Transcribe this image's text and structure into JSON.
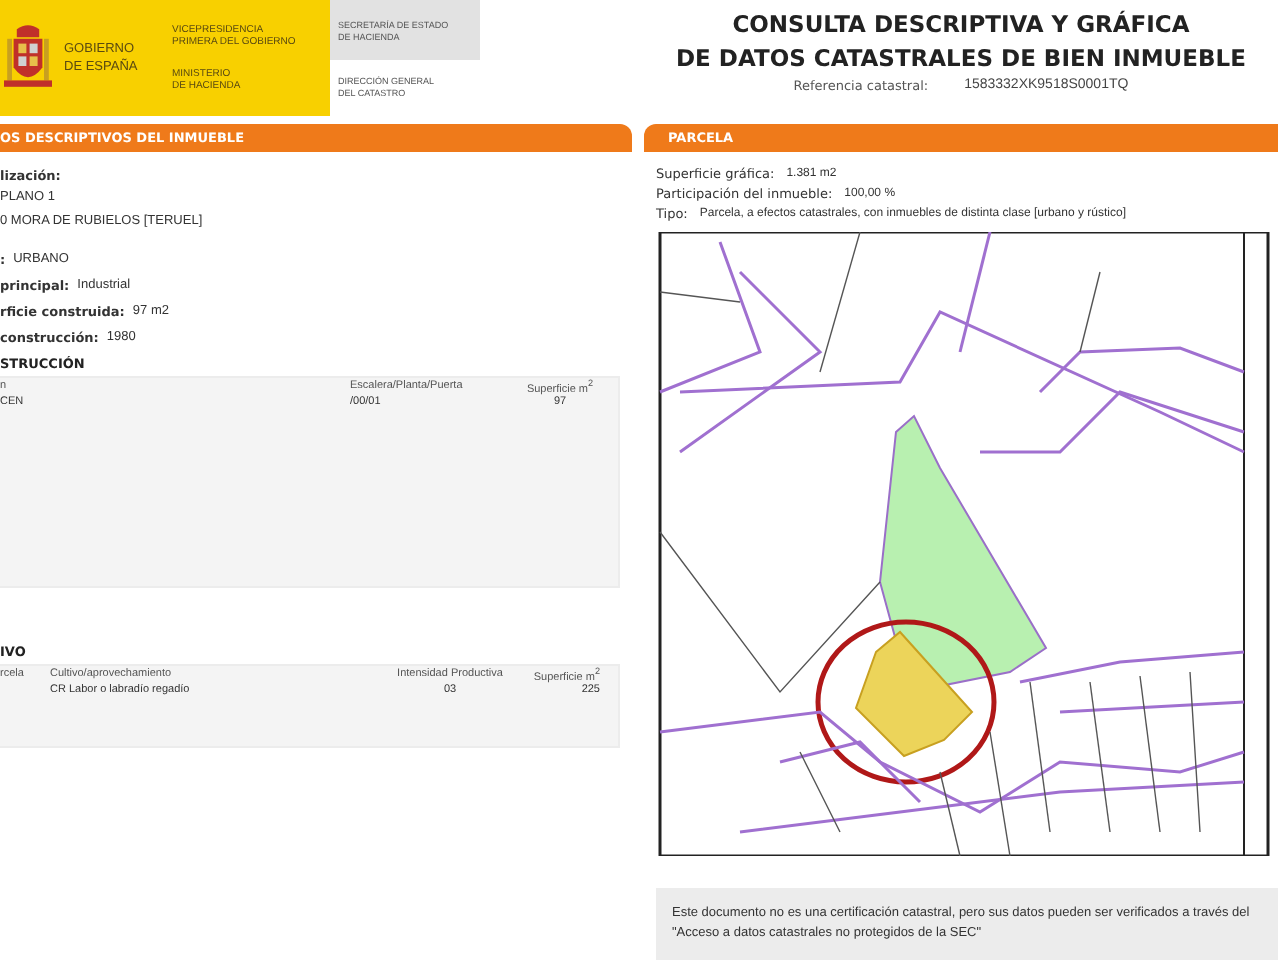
{
  "header": {
    "government": [
      "GOBIERNO",
      "DE ESPAÑA"
    ],
    "vicepresidency": [
      "VICEPRESIDENCIA",
      "PRIMERA DEL GOBIERNO"
    ],
    "ministry": [
      "MINISTERIO",
      "DE HACIENDA"
    ],
    "secretariat": [
      "SECRETARÍA DE ESTADO",
      "DE HACIENDA"
    ],
    "directorate": [
      "DIRECCIÓN GENERAL",
      "DEL CATASTRO"
    ],
    "title": [
      "CONSULTA DESCRIPTIVA Y GRÁFICA",
      "DE DATOS CATASTRALES DE BIEN INMUEBLE"
    ],
    "reference_label": "Referencia catastral:",
    "reference_value": "1583332XK9518S0001TQ"
  },
  "descriptive": {
    "heading": "OS DESCRIPTIVOS DEL INMUEBLE",
    "location_label": "lización:",
    "location_lines": [
      "PLANO 1",
      "0 MORA DE RUBIELOS [TERUEL]"
    ],
    "fields": [
      {
        "label": ": ",
        "value": "URBANO"
      },
      {
        "label": "principal:",
        "value": "Industrial"
      },
      {
        "label": "rficie construida:",
        "value": "97 m2"
      },
      {
        "label": "construcción:",
        "value": "1980"
      }
    ],
    "construction": {
      "heading": "STRUCCIÓN",
      "columns": [
        "n",
        "Escalera/Planta/Puerta",
        "Superficie m$^{2}$"
      ],
      "rows": [
        [
          "CEN",
          "/00/01",
          "97"
        ]
      ]
    },
    "crop": {
      "heading": "IVO",
      "columns": [
        "rcela",
        "Cultivo/aprovechamiento",
        "Intensidad Productiva",
        "Superficie m$^{2}$"
      ],
      "rows": [
        [
          "",
          "CR Labor o labradío regadío",
          "03",
          "225"
        ]
      ]
    }
  },
  "parcel": {
    "heading": "PARCELA",
    "fields": [
      {
        "label": "Superficie gráfica:",
        "value": "1.381 m2"
      },
      {
        "label": "Participación del inmueble:",
        "value": "100,00 %"
      },
      {
        "label": "Tipo:",
        "value": "Parcela, a efectos catastrales, con inmuebles de distinta clase [urbano y rústico]"
      }
    ]
  },
  "footer": {
    "note": "Este documento no es una certificación catastral, pero sus datos pueden ser verificados a través del \"Acceso a datos catastrales no protegidos de la SEC\""
  }
}
